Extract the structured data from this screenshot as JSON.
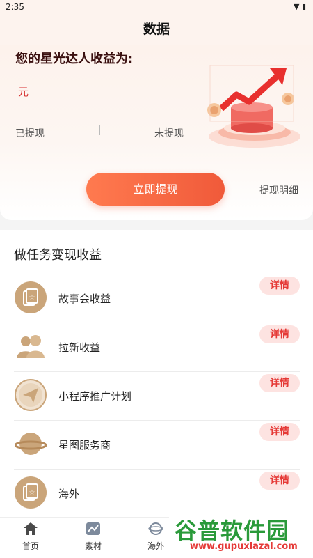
{
  "status_bar": {
    "time": "2:35"
  },
  "header": {
    "title": "数据"
  },
  "earnings": {
    "title": "您的星光达人收益为:",
    "currency": "元",
    "withdrawn_label": "已提现",
    "not_withdrawn_label": "未提现",
    "withdraw_button": "立即提现",
    "withdraw_detail_link": "提现明细"
  },
  "tasks": {
    "section_title": "做任务变现收益",
    "items": [
      {
        "label": "故事会收益",
        "detail": "详情",
        "icon": "card-star-icon"
      },
      {
        "label": "拉新收益",
        "detail": "详情",
        "icon": "users-icon"
      },
      {
        "label": "小程序推广计划",
        "detail": "详情",
        "icon": "paper-plane-icon"
      },
      {
        "label": "星图服务商",
        "detail": "详情",
        "icon": "planet-icon"
      },
      {
        "label": "海外",
        "detail": "详情",
        "icon": "card-star-icon"
      }
    ]
  },
  "tabbar": {
    "items": [
      {
        "label": "首页",
        "icon": "home-icon"
      },
      {
        "label": "素材",
        "icon": "image-chart-icon"
      },
      {
        "label": "海外",
        "icon": "globe-icon"
      }
    ]
  },
  "watermark": {
    "main": "谷普软件园",
    "sub": "www.gupuxlazal.com"
  },
  "colors": {
    "accent": "#f05a3a",
    "detail_bg": "#fde3e1",
    "detail_text": "#e53a37",
    "icon_gold": "#c9a070"
  }
}
